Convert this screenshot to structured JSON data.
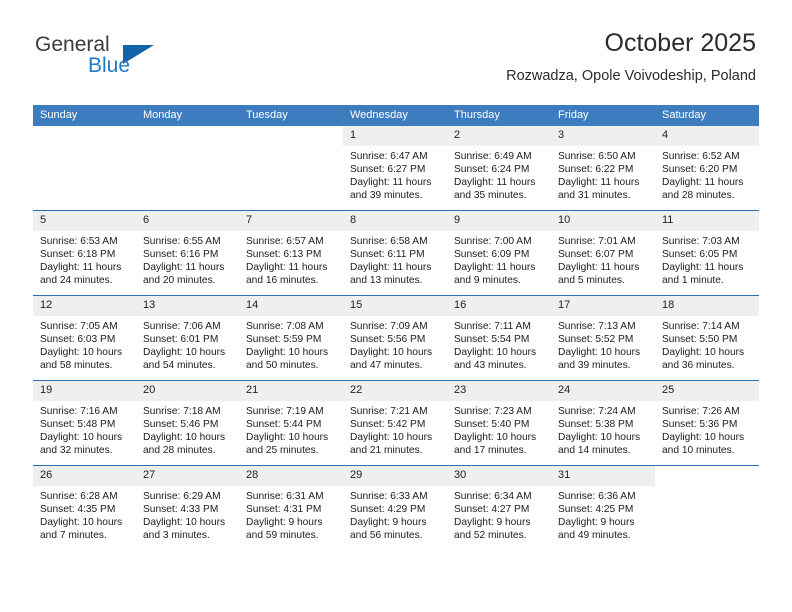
{
  "brand": {
    "name_part1": "General",
    "name_part2": "Blue",
    "logo_icon": "triangle-logo-icon",
    "accent_color": "#1263a8",
    "blue_text_color": "#1f7ac4"
  },
  "header": {
    "title": "October 2025",
    "subtitle": "Rozwadza, Opole Voivodeship, Poland",
    "header_bg_color": "#3d7dbf",
    "row_divider_color": "#2f6fad",
    "daynum_bg_color": "#efefef"
  },
  "weekday_headers": [
    "Sunday",
    "Monday",
    "Tuesday",
    "Wednesday",
    "Thursday",
    "Friday",
    "Saturday"
  ],
  "weeks": [
    {
      "days": [
        {
          "num": "",
          "blank": true,
          "sunrise": "",
          "sunset": "",
          "daylight_line1": "",
          "daylight_line2": ""
        },
        {
          "num": "",
          "blank": true,
          "sunrise": "",
          "sunset": "",
          "daylight_line1": "",
          "daylight_line2": ""
        },
        {
          "num": "",
          "blank": true,
          "sunrise": "",
          "sunset": "",
          "daylight_line1": "",
          "daylight_line2": ""
        },
        {
          "num": "1",
          "blank": false,
          "sunrise": "Sunrise: 6:47 AM",
          "sunset": "Sunset: 6:27 PM",
          "daylight_line1": "Daylight: 11 hours",
          "daylight_line2": "and 39 minutes."
        },
        {
          "num": "2",
          "blank": false,
          "sunrise": "Sunrise: 6:49 AM",
          "sunset": "Sunset: 6:24 PM",
          "daylight_line1": "Daylight: 11 hours",
          "daylight_line2": "and 35 minutes."
        },
        {
          "num": "3",
          "blank": false,
          "sunrise": "Sunrise: 6:50 AM",
          "sunset": "Sunset: 6:22 PM",
          "daylight_line1": "Daylight: 11 hours",
          "daylight_line2": "and 31 minutes."
        },
        {
          "num": "4",
          "blank": false,
          "sunrise": "Sunrise: 6:52 AM",
          "sunset": "Sunset: 6:20 PM",
          "daylight_line1": "Daylight: 11 hours",
          "daylight_line2": "and 28 minutes."
        }
      ]
    },
    {
      "days": [
        {
          "num": "5",
          "blank": false,
          "sunrise": "Sunrise: 6:53 AM",
          "sunset": "Sunset: 6:18 PM",
          "daylight_line1": "Daylight: 11 hours",
          "daylight_line2": "and 24 minutes."
        },
        {
          "num": "6",
          "blank": false,
          "sunrise": "Sunrise: 6:55 AM",
          "sunset": "Sunset: 6:16 PM",
          "daylight_line1": "Daylight: 11 hours",
          "daylight_line2": "and 20 minutes."
        },
        {
          "num": "7",
          "blank": false,
          "sunrise": "Sunrise: 6:57 AM",
          "sunset": "Sunset: 6:13 PM",
          "daylight_line1": "Daylight: 11 hours",
          "daylight_line2": "and 16 minutes."
        },
        {
          "num": "8",
          "blank": false,
          "sunrise": "Sunrise: 6:58 AM",
          "sunset": "Sunset: 6:11 PM",
          "daylight_line1": "Daylight: 11 hours",
          "daylight_line2": "and 13 minutes."
        },
        {
          "num": "9",
          "blank": false,
          "sunrise": "Sunrise: 7:00 AM",
          "sunset": "Sunset: 6:09 PM",
          "daylight_line1": "Daylight: 11 hours",
          "daylight_line2": "and 9 minutes."
        },
        {
          "num": "10",
          "blank": false,
          "sunrise": "Sunrise: 7:01 AM",
          "sunset": "Sunset: 6:07 PM",
          "daylight_line1": "Daylight: 11 hours",
          "daylight_line2": "and 5 minutes."
        },
        {
          "num": "11",
          "blank": false,
          "sunrise": "Sunrise: 7:03 AM",
          "sunset": "Sunset: 6:05 PM",
          "daylight_line1": "Daylight: 11 hours",
          "daylight_line2": "and 1 minute."
        }
      ]
    },
    {
      "days": [
        {
          "num": "12",
          "blank": false,
          "sunrise": "Sunrise: 7:05 AM",
          "sunset": "Sunset: 6:03 PM",
          "daylight_line1": "Daylight: 10 hours",
          "daylight_line2": "and 58 minutes."
        },
        {
          "num": "13",
          "blank": false,
          "sunrise": "Sunrise: 7:06 AM",
          "sunset": "Sunset: 6:01 PM",
          "daylight_line1": "Daylight: 10 hours",
          "daylight_line2": "and 54 minutes."
        },
        {
          "num": "14",
          "blank": false,
          "sunrise": "Sunrise: 7:08 AM",
          "sunset": "Sunset: 5:59 PM",
          "daylight_line1": "Daylight: 10 hours",
          "daylight_line2": "and 50 minutes."
        },
        {
          "num": "15",
          "blank": false,
          "sunrise": "Sunrise: 7:09 AM",
          "sunset": "Sunset: 5:56 PM",
          "daylight_line1": "Daylight: 10 hours",
          "daylight_line2": "and 47 minutes."
        },
        {
          "num": "16",
          "blank": false,
          "sunrise": "Sunrise: 7:11 AM",
          "sunset": "Sunset: 5:54 PM",
          "daylight_line1": "Daylight: 10 hours",
          "daylight_line2": "and 43 minutes."
        },
        {
          "num": "17",
          "blank": false,
          "sunrise": "Sunrise: 7:13 AM",
          "sunset": "Sunset: 5:52 PM",
          "daylight_line1": "Daylight: 10 hours",
          "daylight_line2": "and 39 minutes."
        },
        {
          "num": "18",
          "blank": false,
          "sunrise": "Sunrise: 7:14 AM",
          "sunset": "Sunset: 5:50 PM",
          "daylight_line1": "Daylight: 10 hours",
          "daylight_line2": "and 36 minutes."
        }
      ]
    },
    {
      "days": [
        {
          "num": "19",
          "blank": false,
          "sunrise": "Sunrise: 7:16 AM",
          "sunset": "Sunset: 5:48 PM",
          "daylight_line1": "Daylight: 10 hours",
          "daylight_line2": "and 32 minutes."
        },
        {
          "num": "20",
          "blank": false,
          "sunrise": "Sunrise: 7:18 AM",
          "sunset": "Sunset: 5:46 PM",
          "daylight_line1": "Daylight: 10 hours",
          "daylight_line2": "and 28 minutes."
        },
        {
          "num": "21",
          "blank": false,
          "sunrise": "Sunrise: 7:19 AM",
          "sunset": "Sunset: 5:44 PM",
          "daylight_line1": "Daylight: 10 hours",
          "daylight_line2": "and 25 minutes."
        },
        {
          "num": "22",
          "blank": false,
          "sunrise": "Sunrise: 7:21 AM",
          "sunset": "Sunset: 5:42 PM",
          "daylight_line1": "Daylight: 10 hours",
          "daylight_line2": "and 21 minutes."
        },
        {
          "num": "23",
          "blank": false,
          "sunrise": "Sunrise: 7:23 AM",
          "sunset": "Sunset: 5:40 PM",
          "daylight_line1": "Daylight: 10 hours",
          "daylight_line2": "and 17 minutes."
        },
        {
          "num": "24",
          "blank": false,
          "sunrise": "Sunrise: 7:24 AM",
          "sunset": "Sunset: 5:38 PM",
          "daylight_line1": "Daylight: 10 hours",
          "daylight_line2": "and 14 minutes."
        },
        {
          "num": "25",
          "blank": false,
          "sunrise": "Sunrise: 7:26 AM",
          "sunset": "Sunset: 5:36 PM",
          "daylight_line1": "Daylight: 10 hours",
          "daylight_line2": "and 10 minutes."
        }
      ]
    },
    {
      "days": [
        {
          "num": "26",
          "blank": false,
          "sunrise": "Sunrise: 6:28 AM",
          "sunset": "Sunset: 4:35 PM",
          "daylight_line1": "Daylight: 10 hours",
          "daylight_line2": "and 7 minutes."
        },
        {
          "num": "27",
          "blank": false,
          "sunrise": "Sunrise: 6:29 AM",
          "sunset": "Sunset: 4:33 PM",
          "daylight_line1": "Daylight: 10 hours",
          "daylight_line2": "and 3 minutes."
        },
        {
          "num": "28",
          "blank": false,
          "sunrise": "Sunrise: 6:31 AM",
          "sunset": "Sunset: 4:31 PM",
          "daylight_line1": "Daylight: 9 hours",
          "daylight_line2": "and 59 minutes."
        },
        {
          "num": "29",
          "blank": false,
          "sunrise": "Sunrise: 6:33 AM",
          "sunset": "Sunset: 4:29 PM",
          "daylight_line1": "Daylight: 9 hours",
          "daylight_line2": "and 56 minutes."
        },
        {
          "num": "30",
          "blank": false,
          "sunrise": "Sunrise: 6:34 AM",
          "sunset": "Sunset: 4:27 PM",
          "daylight_line1": "Daylight: 9 hours",
          "daylight_line2": "and 52 minutes."
        },
        {
          "num": "31",
          "blank": false,
          "sunrise": "Sunrise: 6:36 AM",
          "sunset": "Sunset: 4:25 PM",
          "daylight_line1": "Daylight: 9 hours",
          "daylight_line2": "and 49 minutes."
        },
        {
          "num": "",
          "blank": true,
          "sunrise": "",
          "sunset": "",
          "daylight_line1": "",
          "daylight_line2": ""
        }
      ]
    }
  ]
}
